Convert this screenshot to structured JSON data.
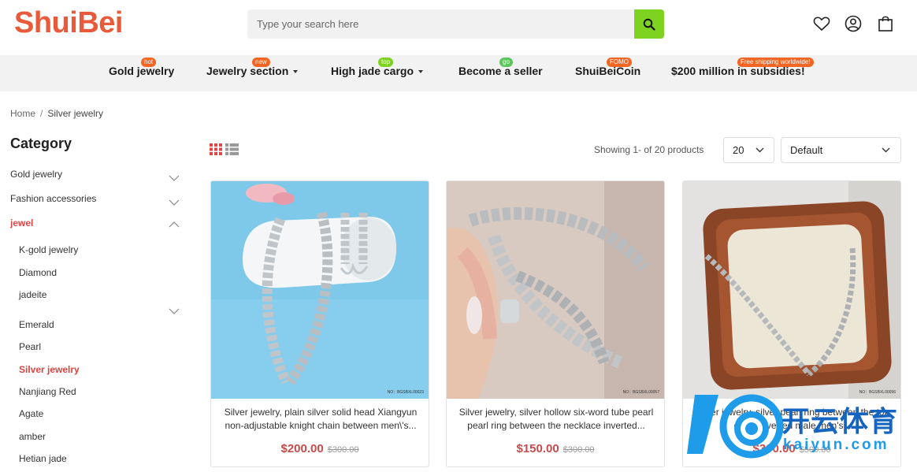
{
  "header": {
    "logo": "ShuiBei",
    "search_placeholder": "Type your search here"
  },
  "nav": {
    "items": [
      {
        "label": "Gold jewelry",
        "tag": "hot",
        "tag_color": "#f26522"
      },
      {
        "label": "Jewelry section",
        "tag": "new",
        "tag_color": "#f26522"
      },
      {
        "label": "High jade cargo",
        "tag": "top",
        "tag_color": "#7ed321"
      },
      {
        "label": "Become a seller",
        "tag": "go",
        "tag_color": "#5cc65c"
      },
      {
        "label": "ShuiBeiCoin",
        "tag": "FOMO",
        "tag_color": "#f26522"
      },
      {
        "label": "$200 million in subsidies!",
        "tag": "Free shipping worldwide!",
        "tag_color": "#f26522"
      }
    ]
  },
  "breadcrumb": {
    "home": "Home",
    "sep": "/",
    "current": "Silver jewelry"
  },
  "sidebar": {
    "title": "Category",
    "categories": [
      {
        "label": "Gold jewelry"
      },
      {
        "label": "Fashion accessories"
      },
      {
        "label": "jewel"
      }
    ],
    "subcategories": [
      {
        "label": "K-gold jewelry"
      },
      {
        "label": "Diamond"
      },
      {
        "label": "jadeite"
      },
      {
        "label": "Emerald"
      },
      {
        "label": "Pearl"
      },
      {
        "label": "Silver jewelry"
      },
      {
        "label": "Nanjiang Red"
      },
      {
        "label": "Agate"
      },
      {
        "label": "amber"
      },
      {
        "label": "Hetian jade"
      }
    ]
  },
  "toolbar": {
    "showing": "Showing 1- of 20 products",
    "per_page": "20",
    "sort": "Default"
  },
  "products": [
    {
      "title": "Silver jewelry, plain silver solid head Xiangyun non-adjustable knight chain between men\\'s...",
      "price": "$200.00",
      "old_price": "$300.00",
      "no": "NO：BGSBXL00023"
    },
    {
      "title": "Silver jewelry, silver hollow six-word tube pearl pearl ring between the necklace inverted...",
      "price": "$150.00",
      "old_price": "$300.00",
      "no": "NO：BGSBXL00057"
    },
    {
      "title": "Silver jewelry, silver pearl ring between the top chain inverted male men's...",
      "price": "$300.00",
      "old_price": "$500.00",
      "no": "NO：BGSBXL00096"
    }
  ],
  "watermark": {
    "cn": "开云体育",
    "en": "kaiyun.com"
  },
  "colors": {
    "brand": "#e85a3a",
    "accent": "#7ed321",
    "price": "#c84b4b",
    "active": "#d9443f"
  }
}
